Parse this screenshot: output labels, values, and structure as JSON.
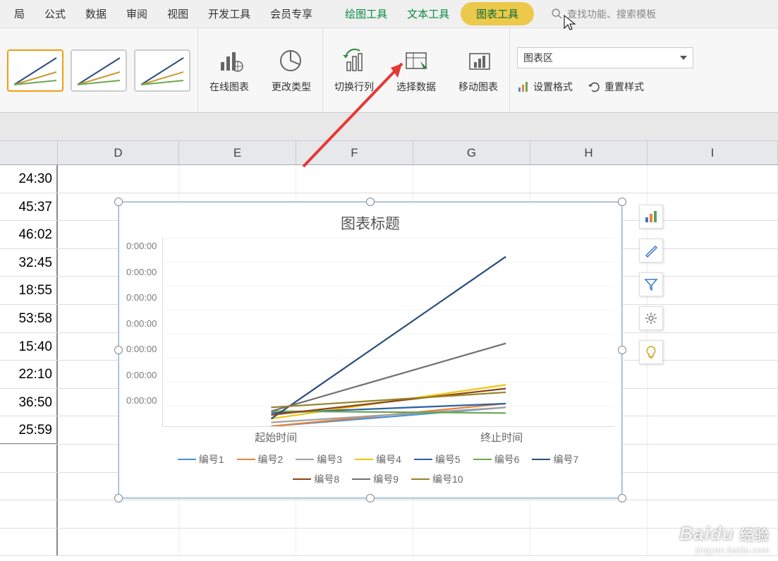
{
  "menu": {
    "items": [
      "局",
      "公式",
      "数据",
      "审阅",
      "视图",
      "开发工具",
      "会员专享"
    ],
    "tool_items": [
      "绘图工具",
      "文本工具",
      "图表工具"
    ],
    "search_placeholder": "查找功能、搜索模板"
  },
  "ribbon": {
    "buttons": [
      {
        "label": "在线图表",
        "icon": "online-chart"
      },
      {
        "label": "更改类型",
        "icon": "change-type"
      },
      {
        "label": "切换行列",
        "icon": "switch-rowcol"
      },
      {
        "label": "选择数据",
        "icon": "select-data"
      },
      {
        "label": "移动图表",
        "icon": "move-chart"
      }
    ],
    "chart_area": {
      "label": "图表区",
      "set_format": "设置格式",
      "reset_style": "重置样式"
    }
  },
  "columns": [
    "",
    "D",
    "E",
    "F",
    "G",
    "H",
    "I"
  ],
  "data_cells": [
    "24:30",
    "45:37",
    "46:02",
    "32:45",
    "18:55",
    "53:58",
    "15:40",
    "22:10",
    "36:50",
    "25:59"
  ],
  "chart": {
    "title": "图表标题",
    "x_labels": [
      "起始时间",
      "终止时间"
    ],
    "y_tick": "0:00:00",
    "y_count": 7
  },
  "chart_data": {
    "type": "line",
    "categories": [
      "起始时间",
      "终止时间"
    ],
    "title": "图表标题",
    "xlabel": "",
    "ylabel": "",
    "series": [
      {
        "name": "编号1",
        "values": [
          0.0,
          0.1
        ],
        "color": "#4a90d9"
      },
      {
        "name": "编号2",
        "values": [
          0.0,
          0.12
        ],
        "color": "#e8833a"
      },
      {
        "name": "编号3",
        "values": [
          0.02,
          0.1
        ],
        "color": "#a0a0a0"
      },
      {
        "name": "编号4",
        "values": [
          0.04,
          0.22
        ],
        "color": "#f1c40f"
      },
      {
        "name": "编号5",
        "values": [
          0.07,
          0.12
        ],
        "color": "#2e5fa8"
      },
      {
        "name": "编号6",
        "values": [
          0.08,
          0.07
        ],
        "color": "#6aa84f"
      },
      {
        "name": "编号7",
        "values": [
          0.04,
          0.9
        ],
        "color": "#2a4e7a"
      },
      {
        "name": "编号8",
        "values": [
          0.06,
          0.2
        ],
        "color": "#8b4513"
      },
      {
        "name": "编号9",
        "values": [
          0.08,
          0.44
        ],
        "color": "#707070"
      },
      {
        "name": "编号10",
        "values": [
          0.1,
          0.18
        ],
        "color": "#968227"
      }
    ],
    "ylim": [
      0,
      1
    ]
  },
  "side_tools": [
    "bar-icon",
    "brush-icon",
    "filter-icon",
    "gear-icon",
    "bulb-icon"
  ],
  "watermark": {
    "main_en": "Baidu",
    "main_cn": "经验",
    "sub": "jingyan.baidu.com"
  }
}
